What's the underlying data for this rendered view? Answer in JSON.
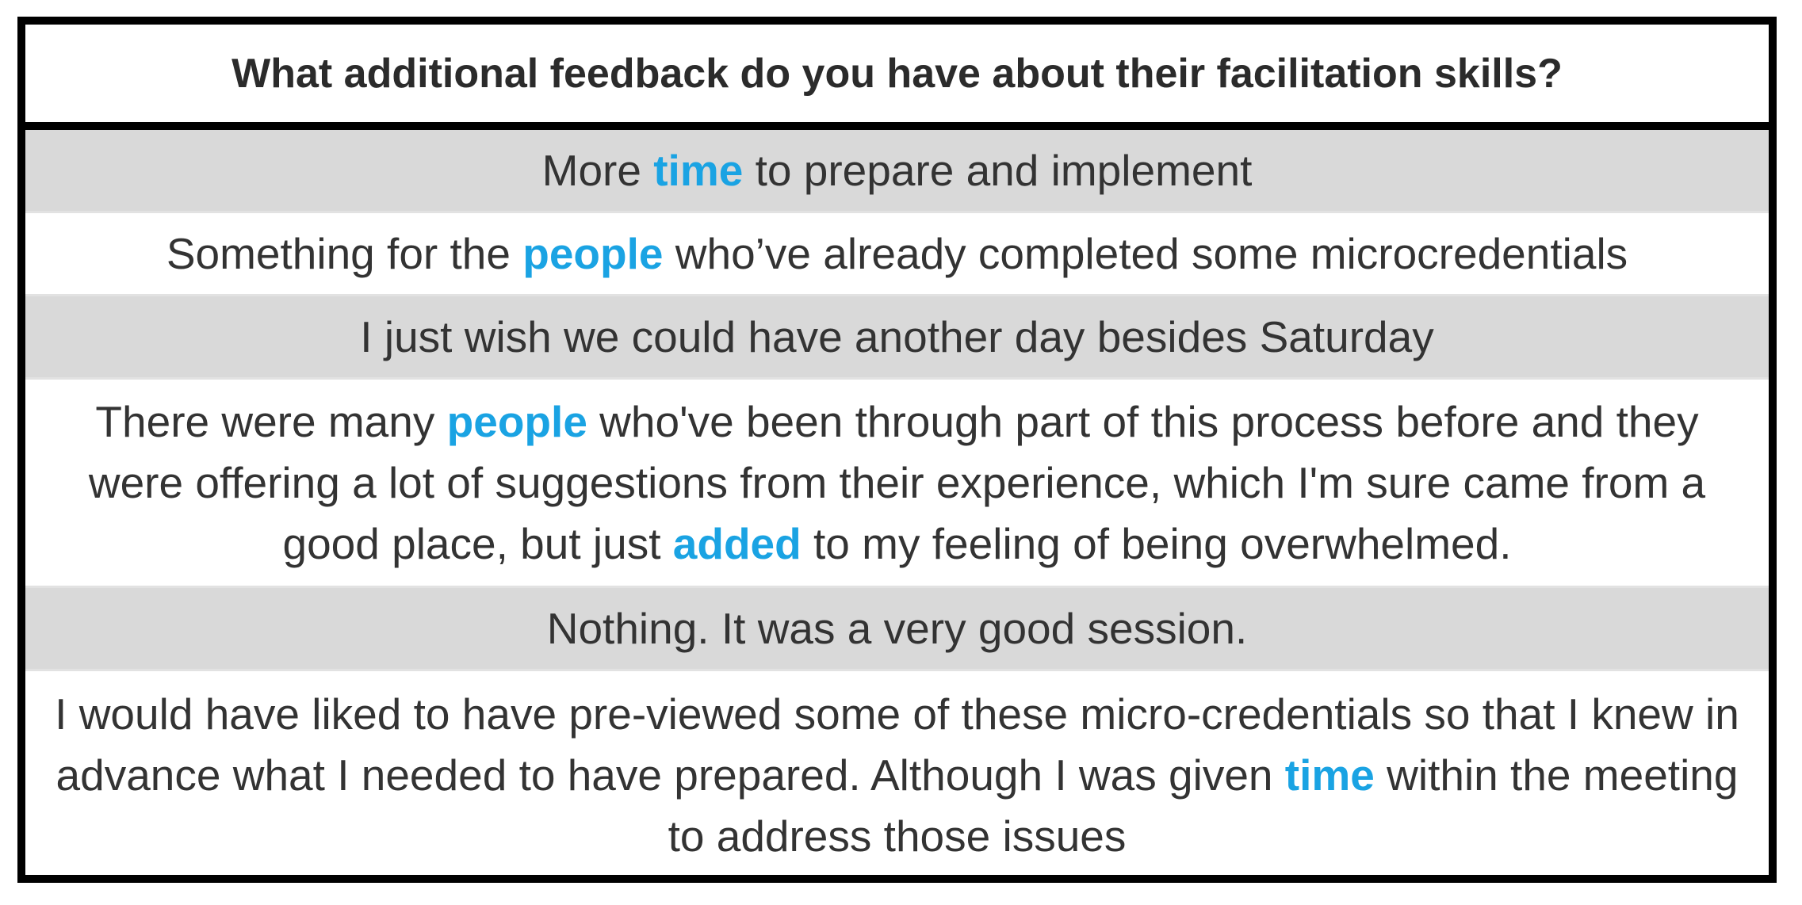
{
  "table": {
    "header": "What additional feedback do you have about their facilitation skills?",
    "highlight_color": "#1aa3e3",
    "rows": [
      {
        "before": "More ",
        "highlight": "time",
        "after": " to prepare and implement"
      },
      {
        "before": "Something for the ",
        "highlight": "people",
        "after": " who’ve already completed some microcredentials"
      },
      {
        "text": "I just wish we could have another day besides Saturday"
      },
      {
        "before": "There were many ",
        "highlight": "people",
        "middle": " who've been through part of this process before and they were offering a lot of suggestions from their experience, which I'm sure came from a good place, but just ",
        "highlight2": "added",
        "after": " to my feeling of being overwhelmed."
      },
      {
        "text": "Nothing. It was a very good session."
      },
      {
        "before": "I would have liked to have pre-viewed some of these micro-credentials so that I knew in advance what I needed to have prepared. Although I was given ",
        "highlight": "time",
        "after": " within the meeting to address those issues"
      }
    ]
  }
}
